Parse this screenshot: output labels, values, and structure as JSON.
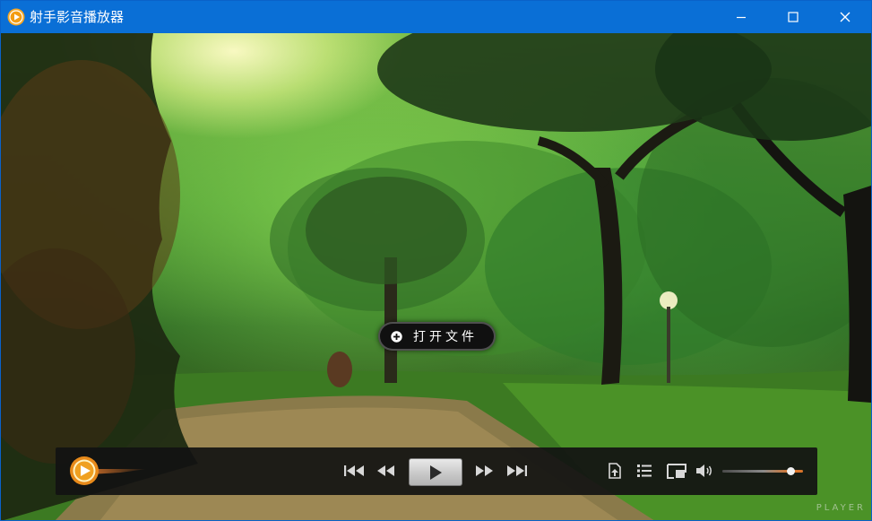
{
  "window": {
    "title": "射手影音播放器",
    "accent_color": "#0a6fd6",
    "controls": {
      "minimize_icon": "minimize-icon",
      "maximize_icon": "maximize-icon",
      "close_icon": "close-icon"
    }
  },
  "player": {
    "open_file_label": "打开文件",
    "open_file_icon": "plus-circle-icon",
    "watermark": "PLAYER"
  },
  "controlbar": {
    "logo_icon": "splayer-logo-icon",
    "buttons": [
      {
        "name": "previous",
        "icon": "skip-back-icon"
      },
      {
        "name": "rewind",
        "icon": "rewind-icon"
      },
      {
        "name": "play",
        "icon": "play-icon"
      },
      {
        "name": "forward",
        "icon": "fast-forward-icon"
      },
      {
        "name": "next",
        "icon": "skip-forward-icon"
      },
      {
        "name": "open",
        "icon": "open-file-icon"
      },
      {
        "name": "playlist",
        "icon": "playlist-icon"
      },
      {
        "name": "fullscreen",
        "icon": "fullscreen-icon"
      },
      {
        "name": "volume",
        "icon": "volume-icon"
      }
    ],
    "volume_level": 0.84,
    "volume_accent_color": "#d9742a"
  }
}
